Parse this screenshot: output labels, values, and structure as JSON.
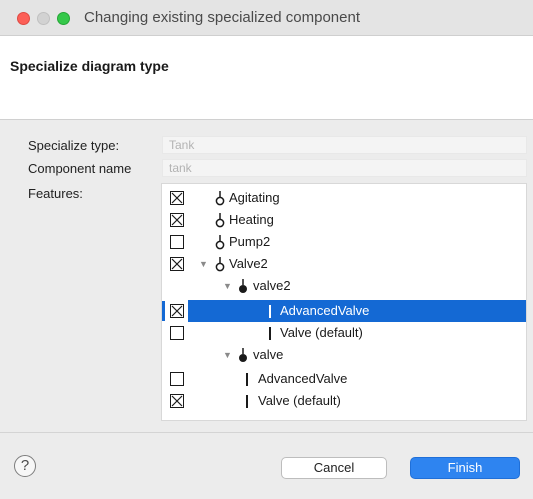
{
  "window": {
    "title": "Changing existing specialized component"
  },
  "header": {
    "title": "Specialize diagram type"
  },
  "form": {
    "specialize_type": {
      "label": "Specialize type:",
      "value": "Tank"
    },
    "component_name": {
      "label": "Component name",
      "value": "tank"
    },
    "features": {
      "label": "Features:"
    }
  },
  "tree": {
    "rows": [
      {
        "label": "Agitating",
        "checked": true,
        "kind": "port",
        "expanded": null,
        "selected": false
      },
      {
        "label": "Heating",
        "checked": true,
        "kind": "port",
        "expanded": null,
        "selected": false
      },
      {
        "label": "Pump2",
        "checked": false,
        "kind": "port",
        "expanded": null,
        "selected": false
      },
      {
        "label": "Valve2",
        "checked": true,
        "kind": "port",
        "expanded": true,
        "selected": false
      },
      {
        "label": "valve2",
        "checked": null,
        "kind": "group",
        "expanded": true,
        "selected": false
      },
      {
        "label": "AdvancedValve",
        "checked": true,
        "kind": "option",
        "expanded": null,
        "selected": true
      },
      {
        "label": "Valve (default)",
        "checked": false,
        "kind": "option",
        "expanded": null,
        "selected": false
      },
      {
        "label": "valve",
        "checked": null,
        "kind": "group",
        "expanded": true,
        "selected": false
      },
      {
        "label": "AdvancedValve",
        "checked": false,
        "kind": "option",
        "expanded": null,
        "selected": false
      },
      {
        "label": "Valve (default)",
        "checked": true,
        "kind": "option",
        "expanded": null,
        "selected": false
      }
    ]
  },
  "footer": {
    "help_icon": "?",
    "cancel_label": "Cancel",
    "finish_label": "Finish"
  },
  "colors": {
    "selection": "#1469d4",
    "primary_button": "#2e84f0",
    "traffic_close": "#fc5f57",
    "traffic_max": "#35c84a"
  }
}
